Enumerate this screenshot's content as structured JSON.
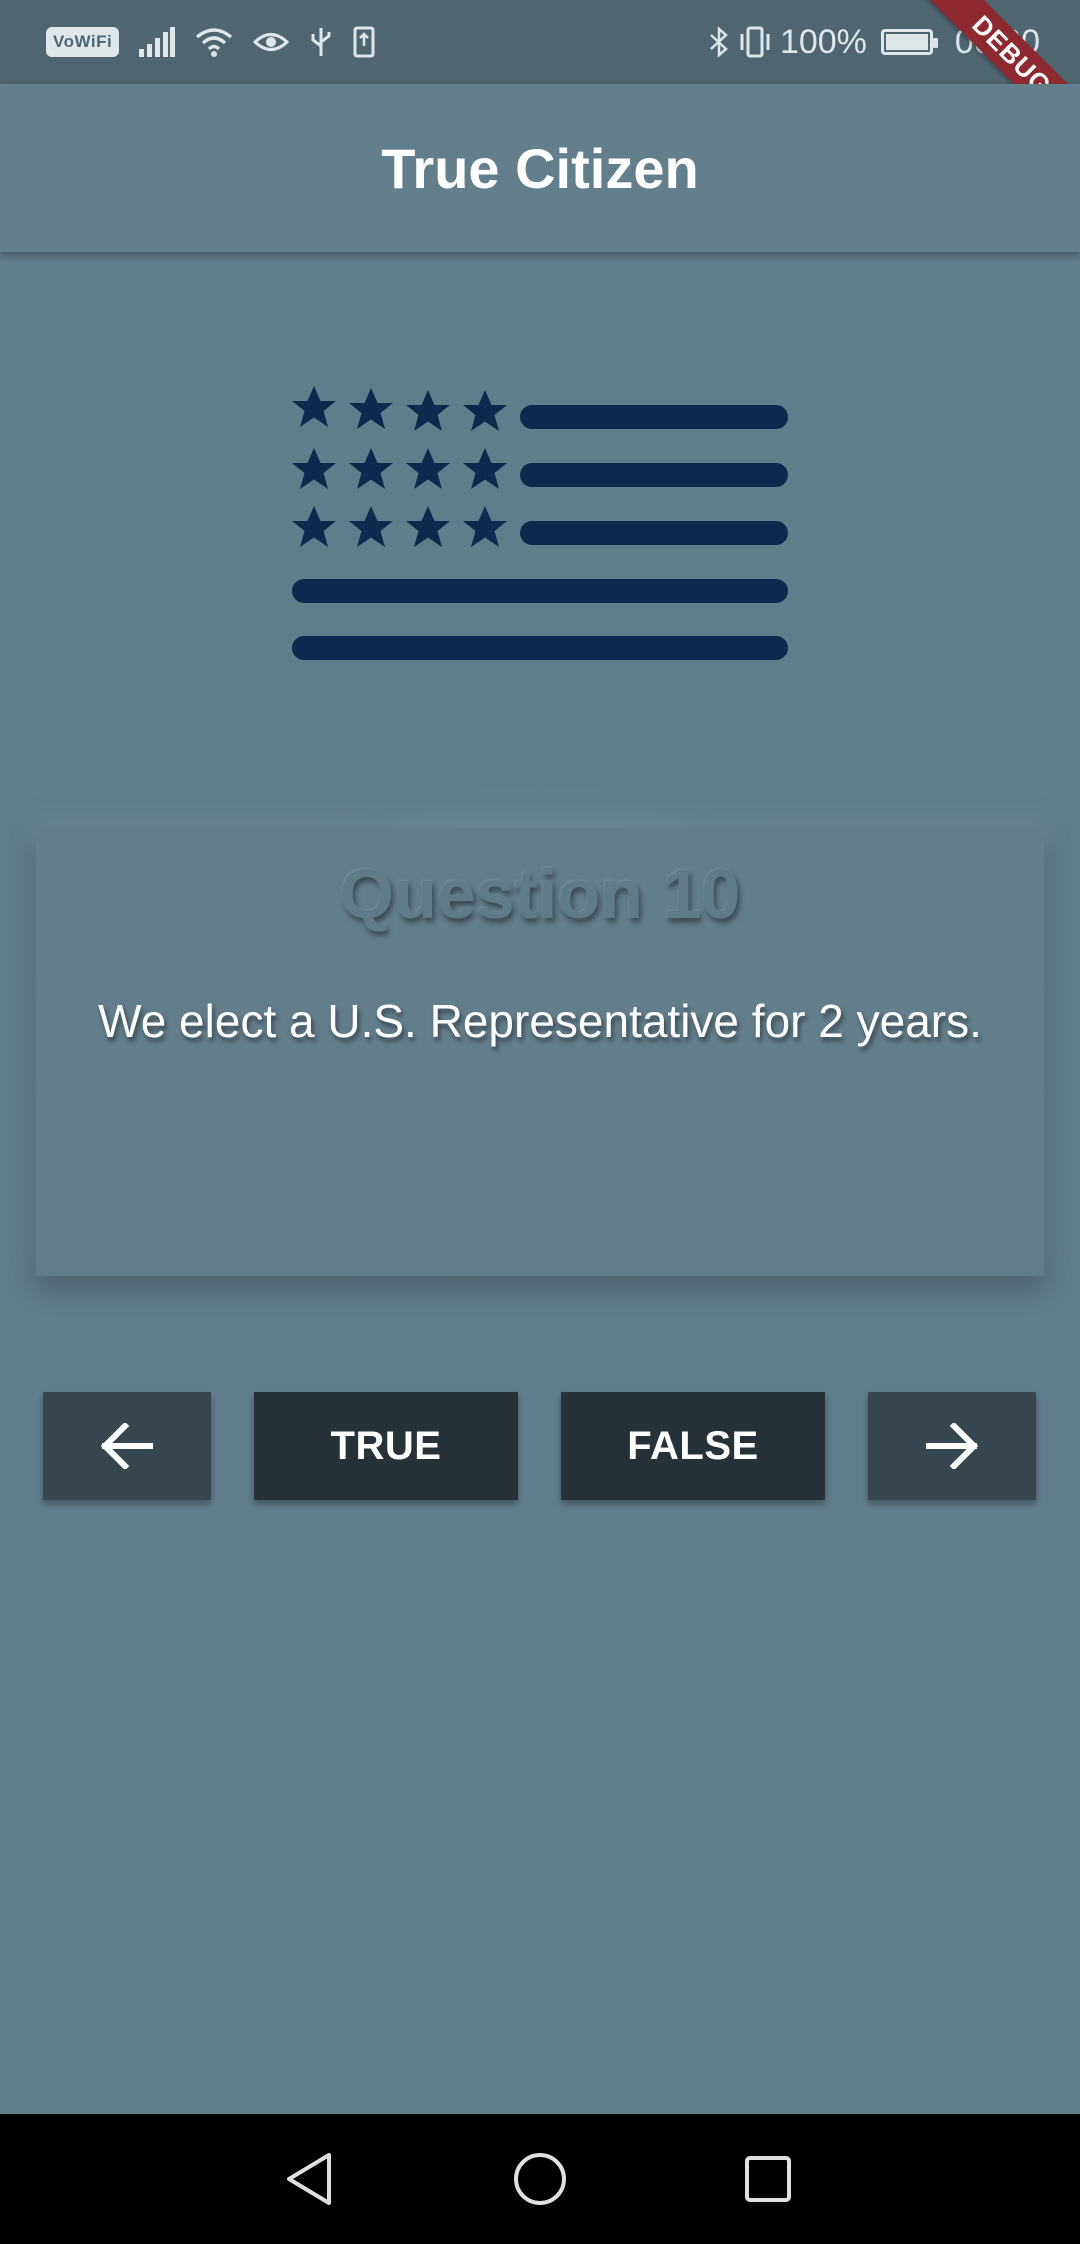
{
  "status_bar": {
    "vowifi": "VoWiFi",
    "battery_percent": "100%",
    "time": "00:00",
    "icons": [
      "signal-icon",
      "wifi-icon",
      "eye-icon",
      "usb-icon",
      "sim-icon",
      "bluetooth-icon",
      "vibrate-icon",
      "battery-icon"
    ]
  },
  "debug_banner": "DEBUG",
  "app_bar": {
    "title": "True Citizen"
  },
  "flag_icon": "flag-icon",
  "question": {
    "title": "Question 10",
    "text": "We elect a U.S. Representative for 2 years."
  },
  "buttons": {
    "prev_icon": "arrow-left-icon",
    "true_label": "TRUE",
    "false_label": "FALSE",
    "next_icon": "arrow-right-icon"
  },
  "colors": {
    "background": "#607d8b",
    "nav_button": "#37474f",
    "answer_button": "#263238",
    "flag": "#0d2a4e",
    "debug": "#8e2a2f"
  },
  "nav_bar": {
    "icons": [
      "back-icon",
      "home-icon",
      "recents-icon"
    ]
  }
}
